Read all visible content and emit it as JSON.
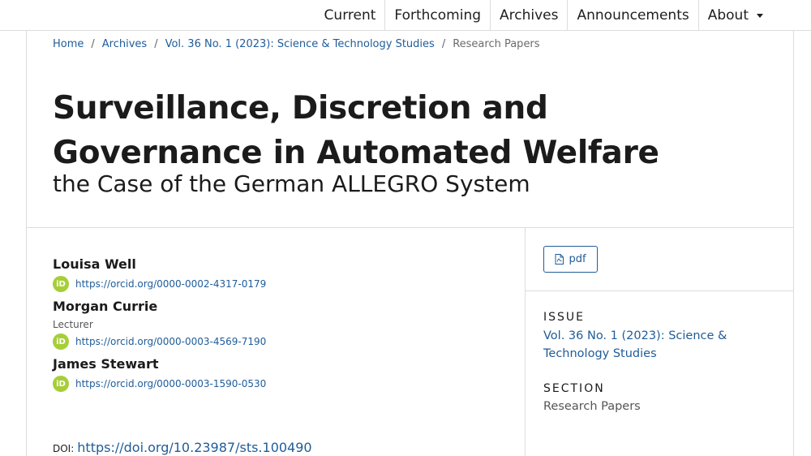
{
  "nav": {
    "items": [
      {
        "label": "Current"
      },
      {
        "label": "Forthcoming"
      },
      {
        "label": "Archives"
      },
      {
        "label": "Announcements"
      },
      {
        "label": "About"
      }
    ]
  },
  "breadcrumb": {
    "home": "Home",
    "archives": "Archives",
    "issue": "Vol. 36 No. 1 (2023): Science & Technology Studies",
    "current": "Research Papers",
    "separator": "/"
  },
  "article": {
    "title": "Surveillance, Discretion and Governance in Automated Welfare",
    "subtitle": "the Case of the German ALLEGRO System"
  },
  "authors": [
    {
      "name": "Louisa Well",
      "affiliation": "",
      "orcid": "https://orcid.org/0000-0002-4317-0179"
    },
    {
      "name": "Morgan Currie",
      "affiliation": "Lecturer",
      "orcid": "https://orcid.org/0000-0003-4569-7190"
    },
    {
      "name": "James Stewart",
      "affiliation": "",
      "orcid": "https://orcid.org/0000-0003-1590-0530"
    }
  ],
  "orcid_icon_text": "iD",
  "doi": {
    "label": "DOI:",
    "url": "https://doi.org/10.23987/sts.100490"
  },
  "sidebar": {
    "pdf_label": "pdf",
    "issue_heading": "ISSUE",
    "issue_value": "Vol. 36 No. 1 (2023): Science & Technology Studies",
    "section_heading": "SECTION",
    "section_value": "Research Papers"
  },
  "colors": {
    "link": "#1f5c99",
    "orcid": "#a6ce39",
    "border": "#dcdcdc"
  }
}
